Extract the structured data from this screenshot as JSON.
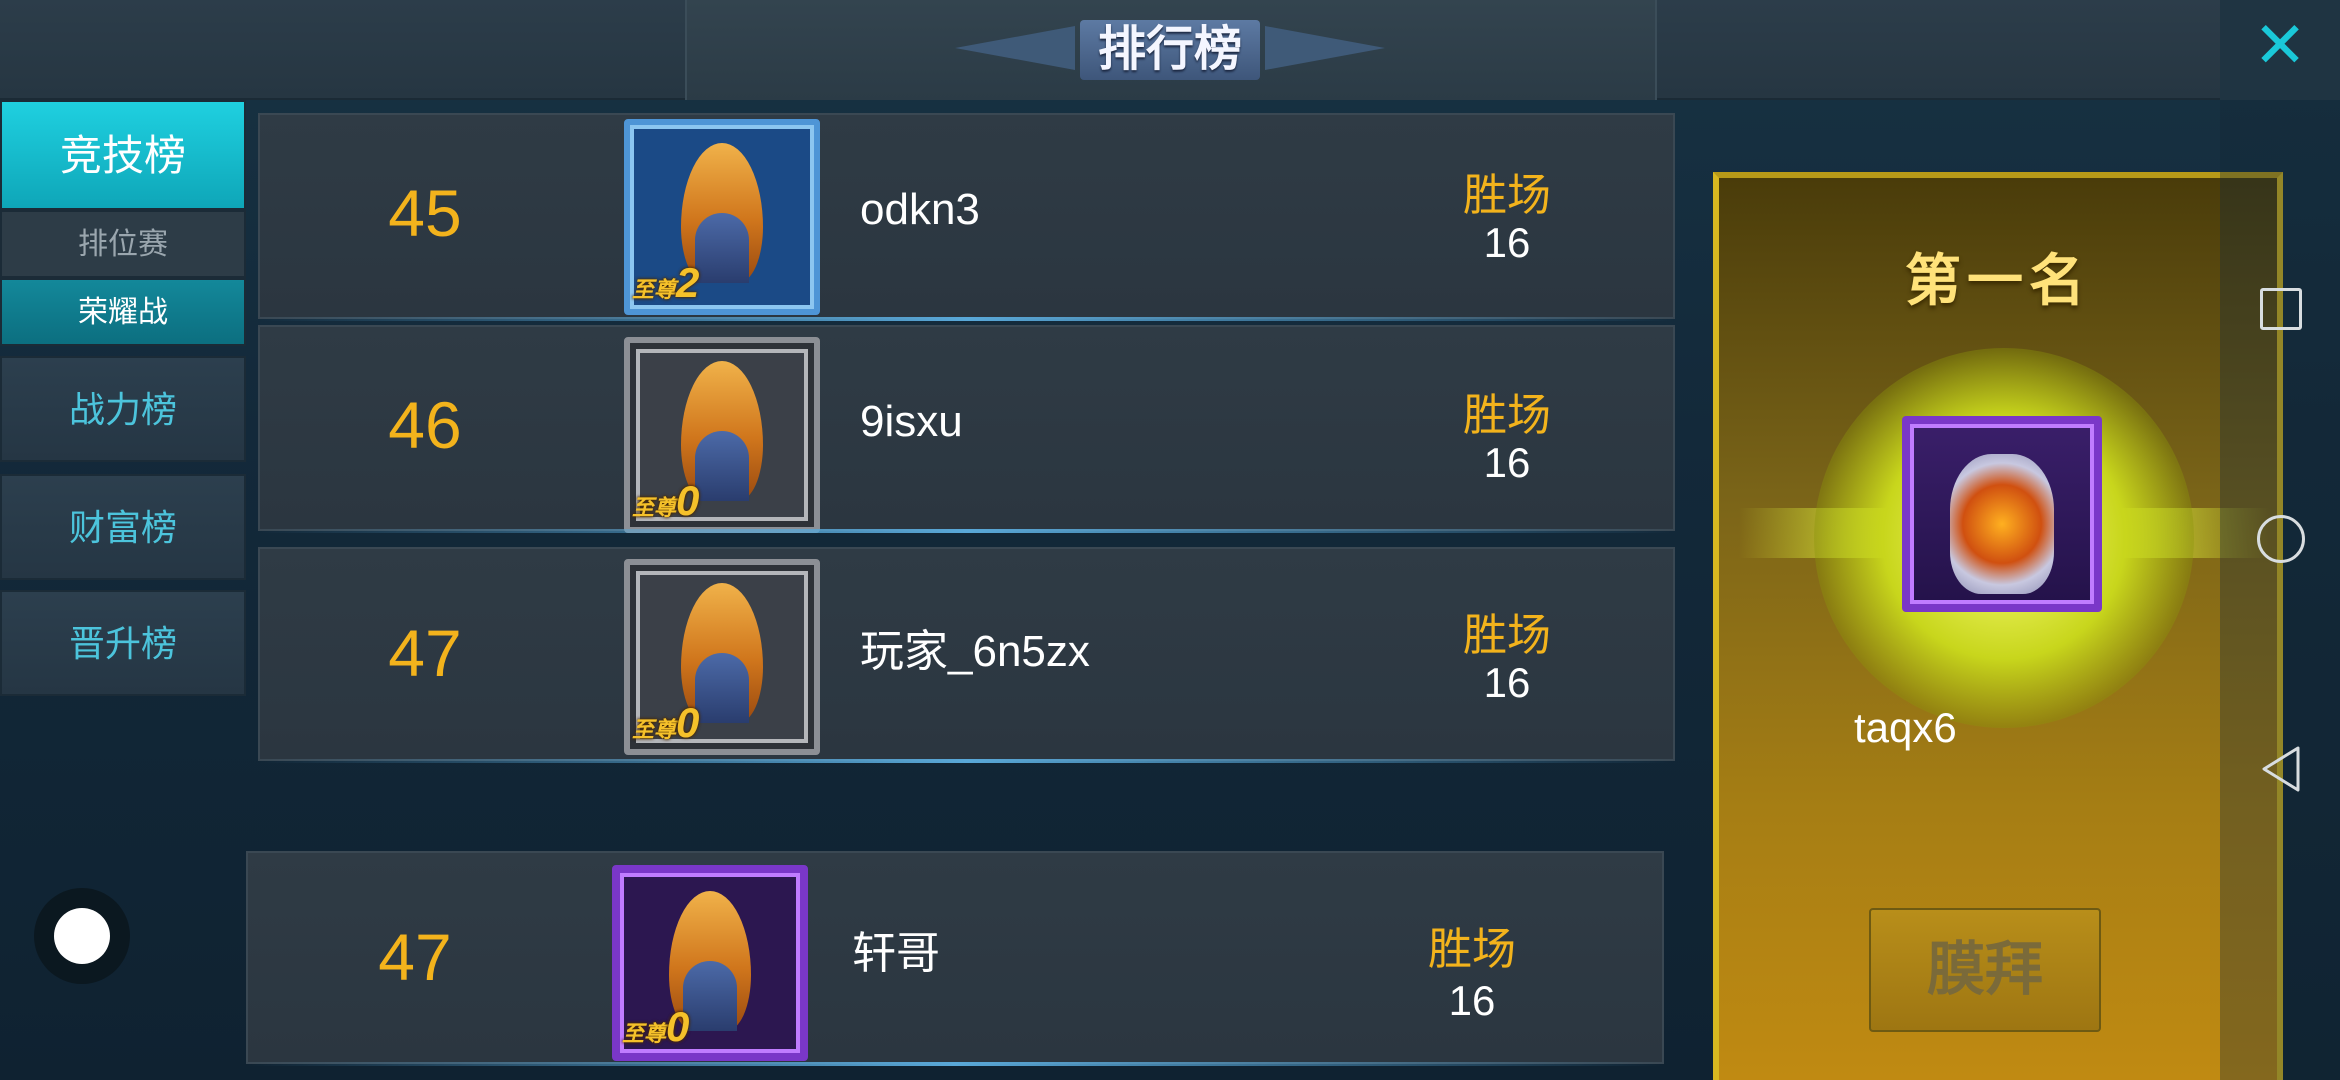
{
  "header": {
    "title": "排行榜",
    "close_icon": "close-icon"
  },
  "nav": {
    "tabs": [
      {
        "label": "竞技榜",
        "active": true
      },
      {
        "label": "战力榜",
        "active": false
      },
      {
        "label": "财富榜",
        "active": false
      },
      {
        "label": "晋升榜",
        "active": false
      }
    ],
    "subtabs": [
      {
        "label": "排位赛",
        "selected": false
      },
      {
        "label": "荣耀战",
        "selected": true
      }
    ]
  },
  "rows": [
    {
      "rank": "45",
      "name": "odkn3",
      "win_label": "胜场",
      "wins": "16",
      "badge_text": "至尊",
      "badge_level": "2",
      "frame": "blue"
    },
    {
      "rank": "46",
      "name": "9isxu",
      "win_label": "胜场",
      "wins": "16",
      "badge_text": "至尊",
      "badge_level": "0",
      "frame": "gray"
    },
    {
      "rank": "47",
      "name": "玩家_6n5zx",
      "win_label": "胜场",
      "wins": "16",
      "badge_text": "至尊",
      "badge_level": "0",
      "frame": "gray"
    }
  ],
  "self_row": {
    "rank": "47",
    "name": "轩哥",
    "win_label": "胜场",
    "wins": "16",
    "badge_text": "至尊",
    "badge_level": "0",
    "frame": "purple"
  },
  "first_place": {
    "title": "第一名",
    "name": "taqx6",
    "button_label": "膜拜"
  },
  "colors": {
    "rank_gold": "#f3b31c",
    "accent_cyan": "#1fd0e0",
    "panel_gold": "#c08a12"
  }
}
